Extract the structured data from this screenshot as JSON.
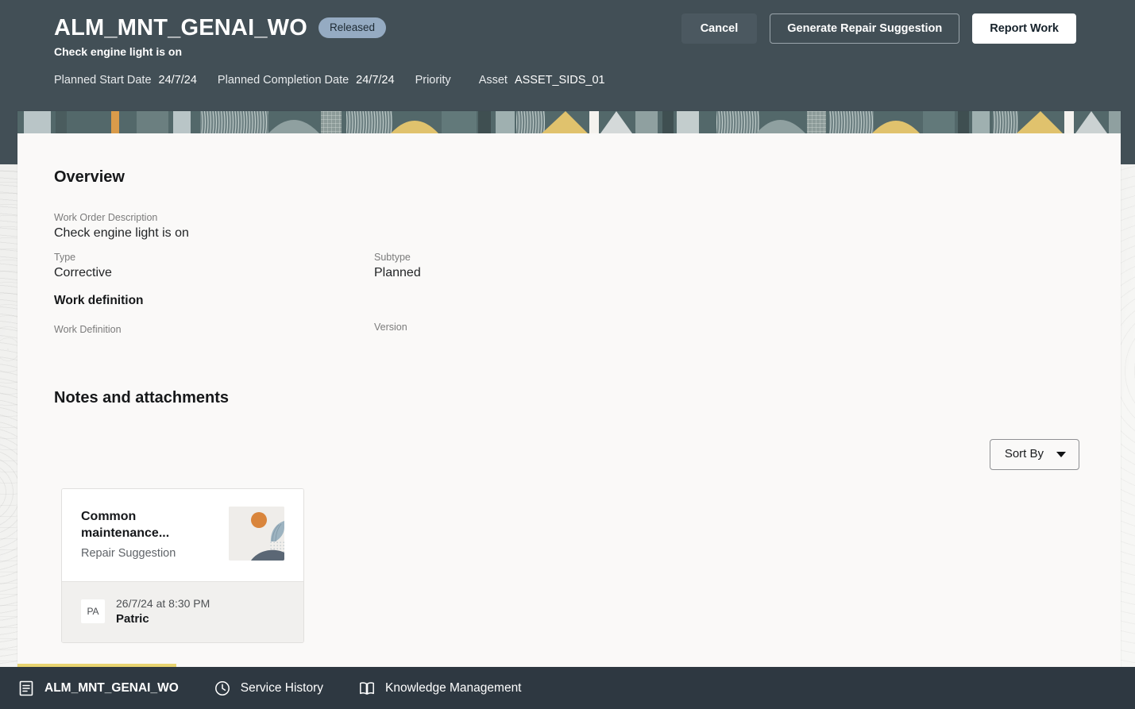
{
  "header": {
    "title": "ALM_MNT_GENAI_WO",
    "status_badge": "Released",
    "subtitle": "Check engine light is on",
    "meta": [
      {
        "label": "Planned Start Date",
        "value": "24/7/24"
      },
      {
        "label": "Planned Completion Date",
        "value": "24/7/24"
      },
      {
        "label": "Priority",
        "value": ""
      },
      {
        "label": "Asset",
        "value": "ASSET_SIDS_01"
      }
    ],
    "actions": {
      "cancel": "Cancel",
      "generate": "Generate Repair Suggestion",
      "report": "Report Work"
    }
  },
  "overview": {
    "title": "Overview",
    "fields": {
      "description": {
        "label": "Work Order Description",
        "value": "Check engine light is on"
      },
      "type": {
        "label": "Type",
        "value": "Corrective"
      },
      "subtype": {
        "label": "Subtype",
        "value": "Planned"
      }
    },
    "work_definition": {
      "title": "Work definition",
      "work_definition": {
        "label": "Work Definition",
        "value": ""
      },
      "version": {
        "label": "Version",
        "value": ""
      }
    }
  },
  "notes": {
    "title": "Notes and attachments",
    "sort_by": "Sort By",
    "cards": [
      {
        "heading": "Common maintenance...",
        "subheading": "Repair Suggestion",
        "author_initials": "PA",
        "date": "26/7/24 at 8:30 PM",
        "author": "Patric"
      }
    ]
  },
  "bottom_nav": {
    "items": [
      {
        "label": "ALM_MNT_GENAI_WO",
        "icon": "document-icon",
        "active": true
      },
      {
        "label": "Service History",
        "icon": "clock-icon",
        "active": false
      },
      {
        "label": "Knowledge Management",
        "icon": "book-icon",
        "active": false
      }
    ]
  },
  "colors": {
    "header_bg": "#424f56",
    "bottom_nav_bg": "#2e3841",
    "badge_bg": "#95abc2",
    "accent_yellow": "#e8d470",
    "card_bg": "#faf9f8"
  }
}
